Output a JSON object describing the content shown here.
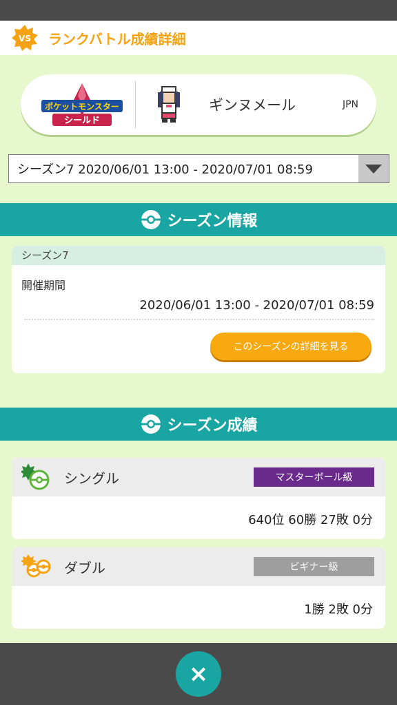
{
  "header": {
    "badge": "VS",
    "title": "ランクバトル成績詳細"
  },
  "trainer": {
    "game_logo_top": "ポケットモンスター",
    "game_logo_bottom": "シールド",
    "name": "ギンヌメール",
    "region": "JPN"
  },
  "season_select": {
    "value": "シーズン7 2020/06/01 13:00 - 2020/07/01 08:59"
  },
  "season_info": {
    "section_title": "シーズン情報",
    "card_title": "シーズン7",
    "period_label": "開催期間",
    "period_value": "2020/06/01 13:00 - 2020/07/01 08:59",
    "detail_button": "このシーズンの詳細を見る"
  },
  "season_results": {
    "section_title": "シーズン成績",
    "single": {
      "name": "シングル",
      "rank": "マスターボール級",
      "rank_color": "#6a2a8c",
      "stats": "640位 60勝 27敗 0分"
    },
    "double": {
      "name": "ダブル",
      "rank": "ビギナー級",
      "rank_color": "#9e9e9e",
      "stats": "1勝 2敗 0分"
    }
  },
  "footer": {
    "close_symbol": "×"
  },
  "colors": {
    "accent": "#19a5a2",
    "header_title": "#f5a315",
    "background": "#e7f8cf",
    "button": "#f8a90f"
  }
}
